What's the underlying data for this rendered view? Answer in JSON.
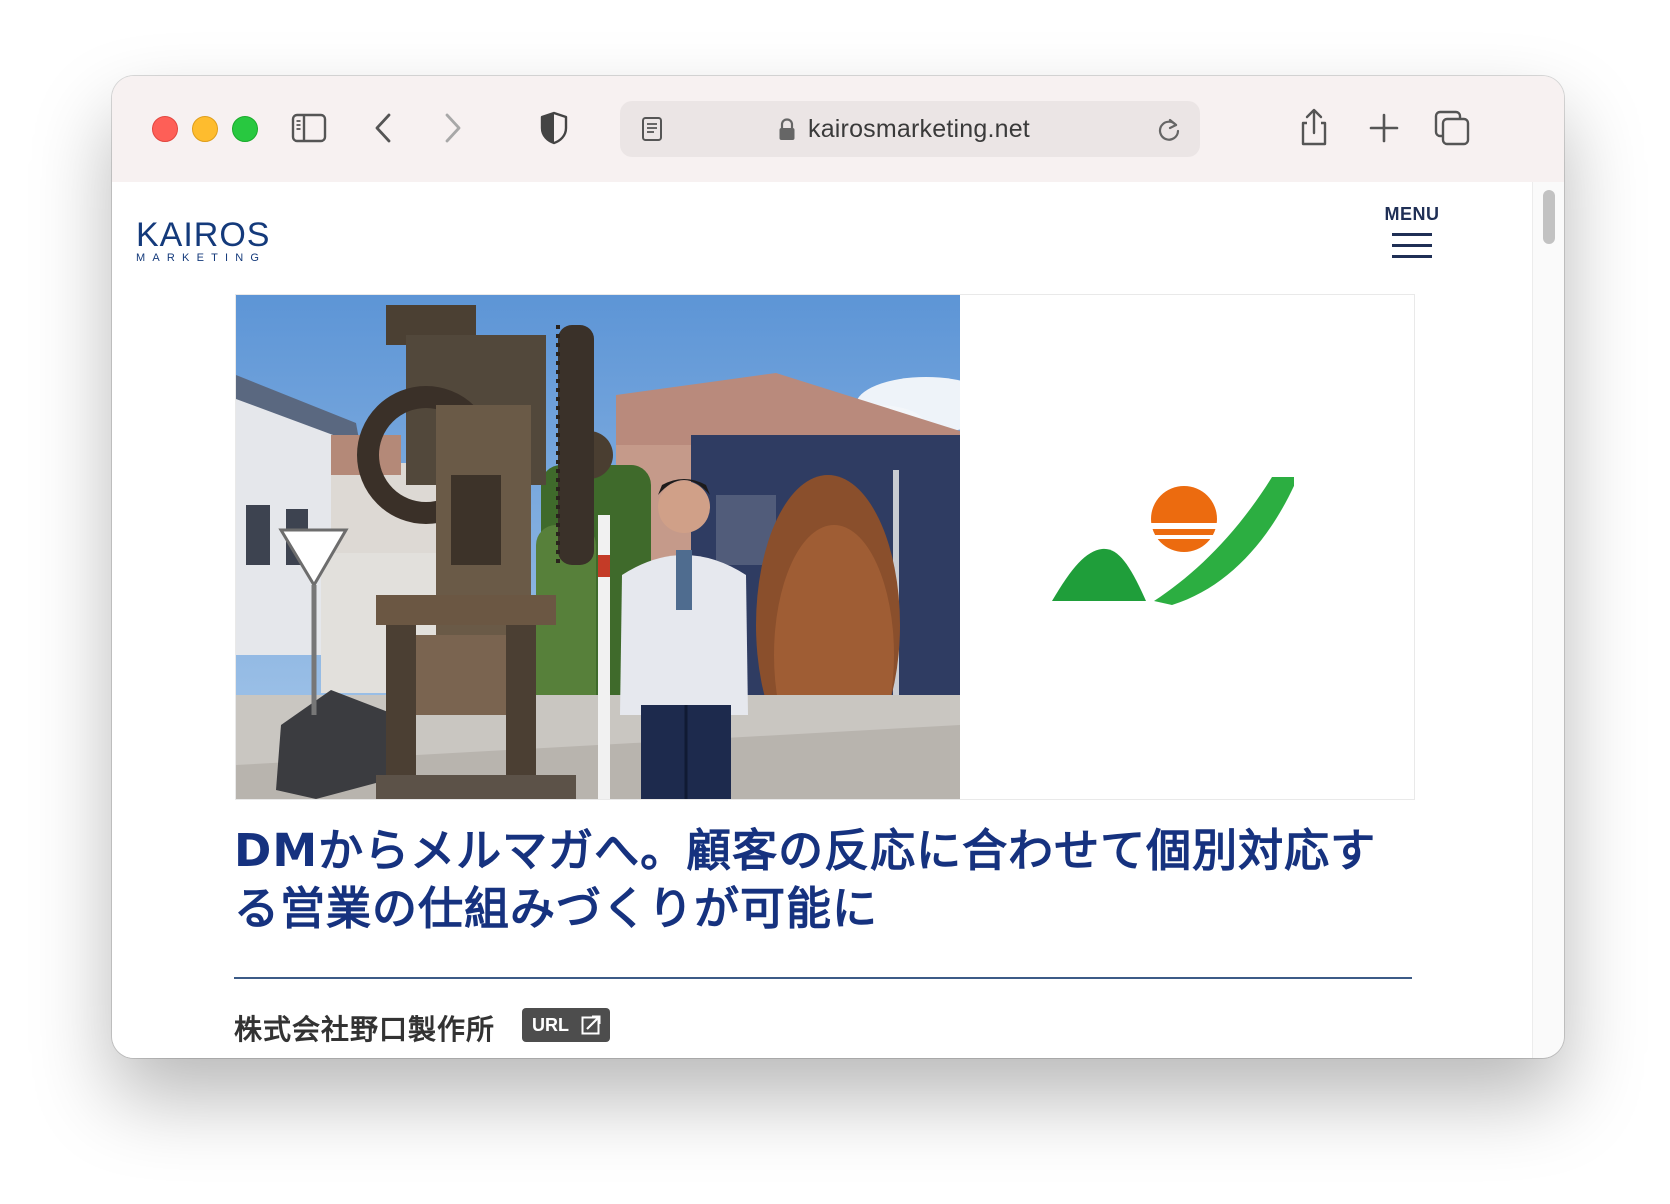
{
  "browser": {
    "url": "kairosmarketing.net",
    "icons": [
      "sidebar-icon",
      "back-icon",
      "forward-icon",
      "shield-icon",
      "reader-icon",
      "lock-icon",
      "reload-icon",
      "share-icon",
      "new-tab-icon",
      "tab-overview-icon"
    ]
  },
  "site": {
    "logo_main": "KAIROS",
    "logo_sub": "MARKETING",
    "menu_label": "MENU"
  },
  "article": {
    "headline_line1": "DMからメルマガへ。顧客の反応に合わせて個別対応す",
    "headline_line2": "る営業の仕組みづくりが可能に",
    "company": "株式会社野口製作所",
    "url_badge": "URL"
  },
  "colors": {
    "accent": "#16327f",
    "logo": "#143a7b",
    "badge": "#4d4d4d",
    "brand_green": "#1fa33b",
    "brand_orange": "#ec6b0f"
  }
}
